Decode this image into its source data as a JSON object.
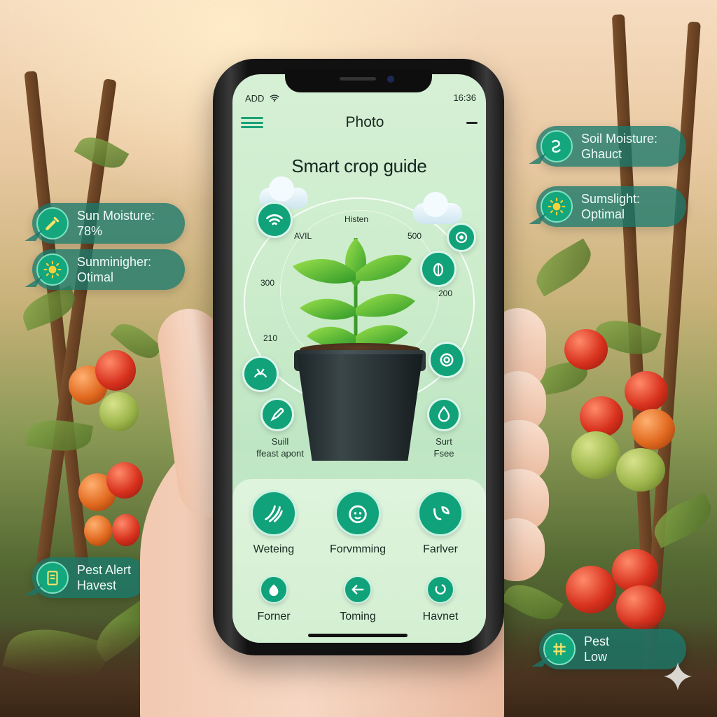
{
  "status_bar": {
    "carrier": "ADD",
    "time": "16:36"
  },
  "header": {
    "title": "Photo"
  },
  "guide": {
    "title": "Smart crop guide"
  },
  "dial": {
    "top_label": "Histen",
    "labels": [
      "AVIL",
      "500",
      "300",
      "200",
      "210"
    ]
  },
  "sensor_labels": {
    "left": {
      "line1": "Suill",
      "line2": "ffeast apont"
    },
    "right": {
      "line1": "Surt",
      "line2": "Fsee"
    }
  },
  "features": [
    {
      "label": "Weteing",
      "icon": "watering-icon"
    },
    {
      "label": "Forvmming",
      "icon": "farming-face-icon"
    },
    {
      "label": "Farlver",
      "icon": "fertilizer-icon"
    },
    {
      "label": "Forner",
      "icon": "leaf-drop-icon"
    },
    {
      "label": "Toming",
      "icon": "arrow-icon"
    },
    {
      "label": "Havnet",
      "icon": "harvest-icon"
    }
  ],
  "chips": {
    "soil_moisture": {
      "title": "Soil Moisture:",
      "value": "Ghauct",
      "icon": "swirl-icon"
    },
    "sunslight": {
      "title": "Sumslight:",
      "value": "Optimal",
      "icon": "sun-icon"
    },
    "sun_moisture": {
      "title": "Sun Moisture:",
      "value": "78%",
      "icon": "probe-icon"
    },
    "sunminigher": {
      "title": "Sunminigher:",
      "value": "Otimal",
      "icon": "sun-icon"
    },
    "pest_alert": {
      "title": "Pest Alert",
      "value": "Havest",
      "icon": "clipboard-icon"
    },
    "pest": {
      "title": "Pest",
      "value": "Low",
      "icon": "grid-icon"
    }
  },
  "colors": {
    "accent": "#10a27a",
    "chip_bg": "#18786c",
    "screen_bg": "#cbeccb"
  }
}
